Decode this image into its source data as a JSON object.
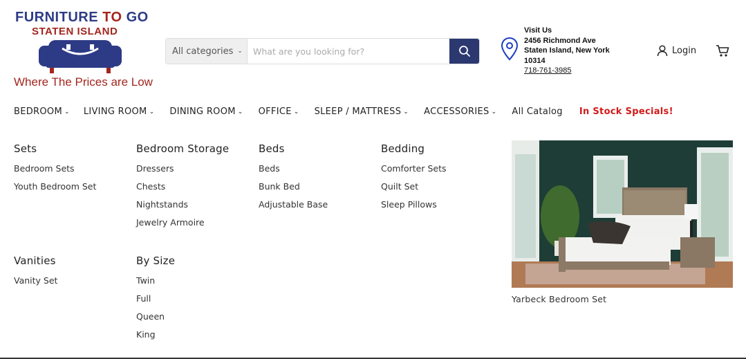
{
  "brand": {
    "line1_part1": "FURNITURE ",
    "line1_part2": "TO",
    "line1_part3": " GO",
    "line2": "STATEN ISLAND",
    "tagline": "Where The Prices are Low"
  },
  "search": {
    "category_label": "All categories",
    "placeholder": "What are you looking for?",
    "value": ""
  },
  "store": {
    "heading": "Visit Us",
    "address1": "2456 Richmond Ave",
    "address2": "Staten Island, New York",
    "zip": "10314",
    "phone": "718-761-3985"
  },
  "account": {
    "login_label": "Login"
  },
  "nav": {
    "items": [
      {
        "label": "BEDROOM"
      },
      {
        "label": "LIVING ROOM"
      },
      {
        "label": "DINING ROOM"
      },
      {
        "label": "OFFICE"
      },
      {
        "label": "SLEEP / MATTRESS"
      },
      {
        "label": "ACCESSORIES"
      },
      {
        "label": "All Catalog"
      },
      {
        "label": "In Stock Specials!"
      }
    ]
  },
  "menu": {
    "sets": {
      "title": "Sets",
      "links": [
        "Bedroom Sets",
        "Youth Bedroom Set"
      ]
    },
    "storage": {
      "title": "Bedroom Storage",
      "links": [
        "Dressers",
        "Chests",
        "Nightstands",
        "Jewelry Armoire"
      ]
    },
    "beds": {
      "title": "Beds",
      "links": [
        "Beds",
        "Bunk Bed",
        "Adjustable Base"
      ]
    },
    "bedding": {
      "title": "Bedding",
      "links": [
        "Comforter Sets",
        "Quilt Set",
        "Sleep Pillows"
      ]
    },
    "vanities": {
      "title": "Vanities",
      "links": [
        "Vanity Set"
      ]
    },
    "bysize": {
      "title": "By Size",
      "links": [
        "Twin",
        "Full",
        "Queen",
        "King"
      ]
    }
  },
  "featured": {
    "caption": "Yarbeck Bedroom Set"
  },
  "colors": {
    "brand_blue": "#2c3870",
    "brand_red": "#a3261e",
    "special_red": "#d21a1a"
  }
}
